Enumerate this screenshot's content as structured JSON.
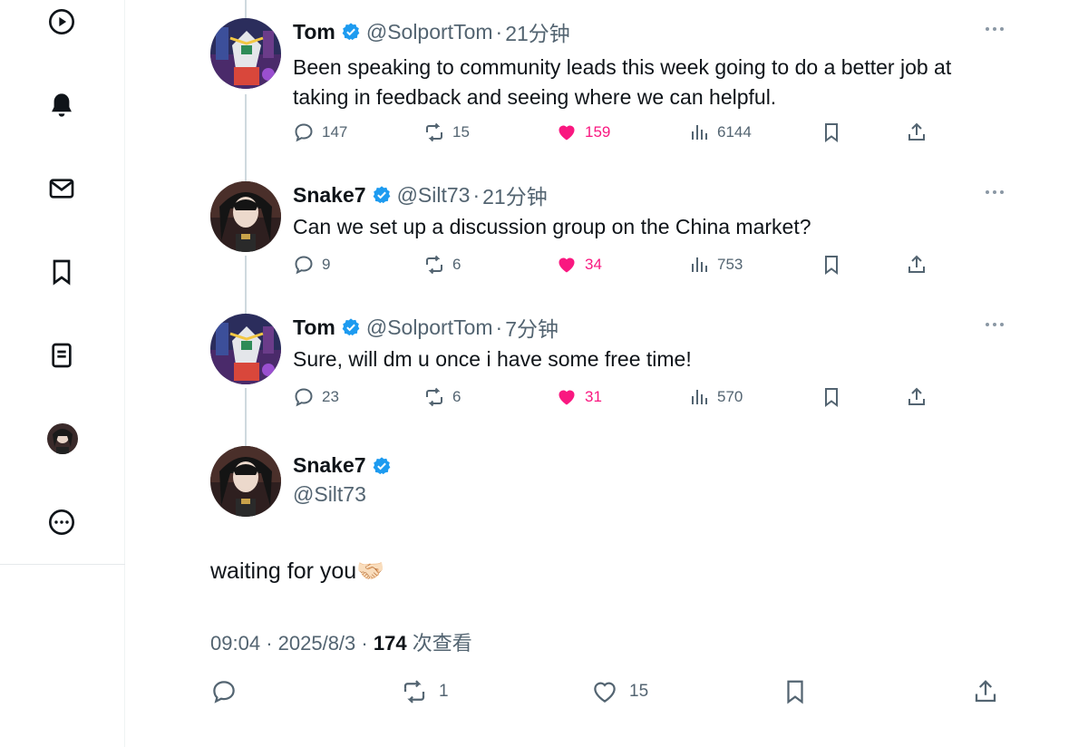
{
  "sidebar": {
    "icons": [
      "play-icon",
      "bell-icon",
      "mail-icon",
      "bookmark-icon",
      "list-icon",
      "avatar",
      "more-icon"
    ]
  },
  "replies": [
    {
      "name": "Tom",
      "handle": "@SolportTom",
      "separator": "·",
      "time": "21分钟",
      "text": "Been speaking to community leads this week going to do a better job at taking in feedback and seeing where we can helpful.",
      "reply_count": "147",
      "retweet_count": "15",
      "like_count": "159",
      "views": "6144"
    },
    {
      "name": "Snake7",
      "handle": "@Silt73",
      "separator": "·",
      "time": "21分钟",
      "text": "Can we set up a discussion group on the China market?",
      "reply_count": "9",
      "retweet_count": "6",
      "like_count": "34",
      "views": "753"
    },
    {
      "name": "Tom",
      "handle": "@SolportTom",
      "separator": "·",
      "time": "7分钟",
      "text": "Sure, will dm u once i have some free time!",
      "reply_count": "23",
      "retweet_count": "6",
      "like_count": "31",
      "views": "570"
    }
  ],
  "main_tweet": {
    "name": "Snake7",
    "handle": "@Silt73",
    "text": "waiting for you",
    "emoji": "🤝🏻",
    "time": "09:04",
    "date": "2025/8/3",
    "separator": "·",
    "views": "174",
    "views_label": "次查看",
    "retweet_count": "1",
    "like_count": "15"
  },
  "colors": {
    "like_pink": "#f91880",
    "verified_blue": "#1d9bf0",
    "muted_gray": "#536471"
  }
}
